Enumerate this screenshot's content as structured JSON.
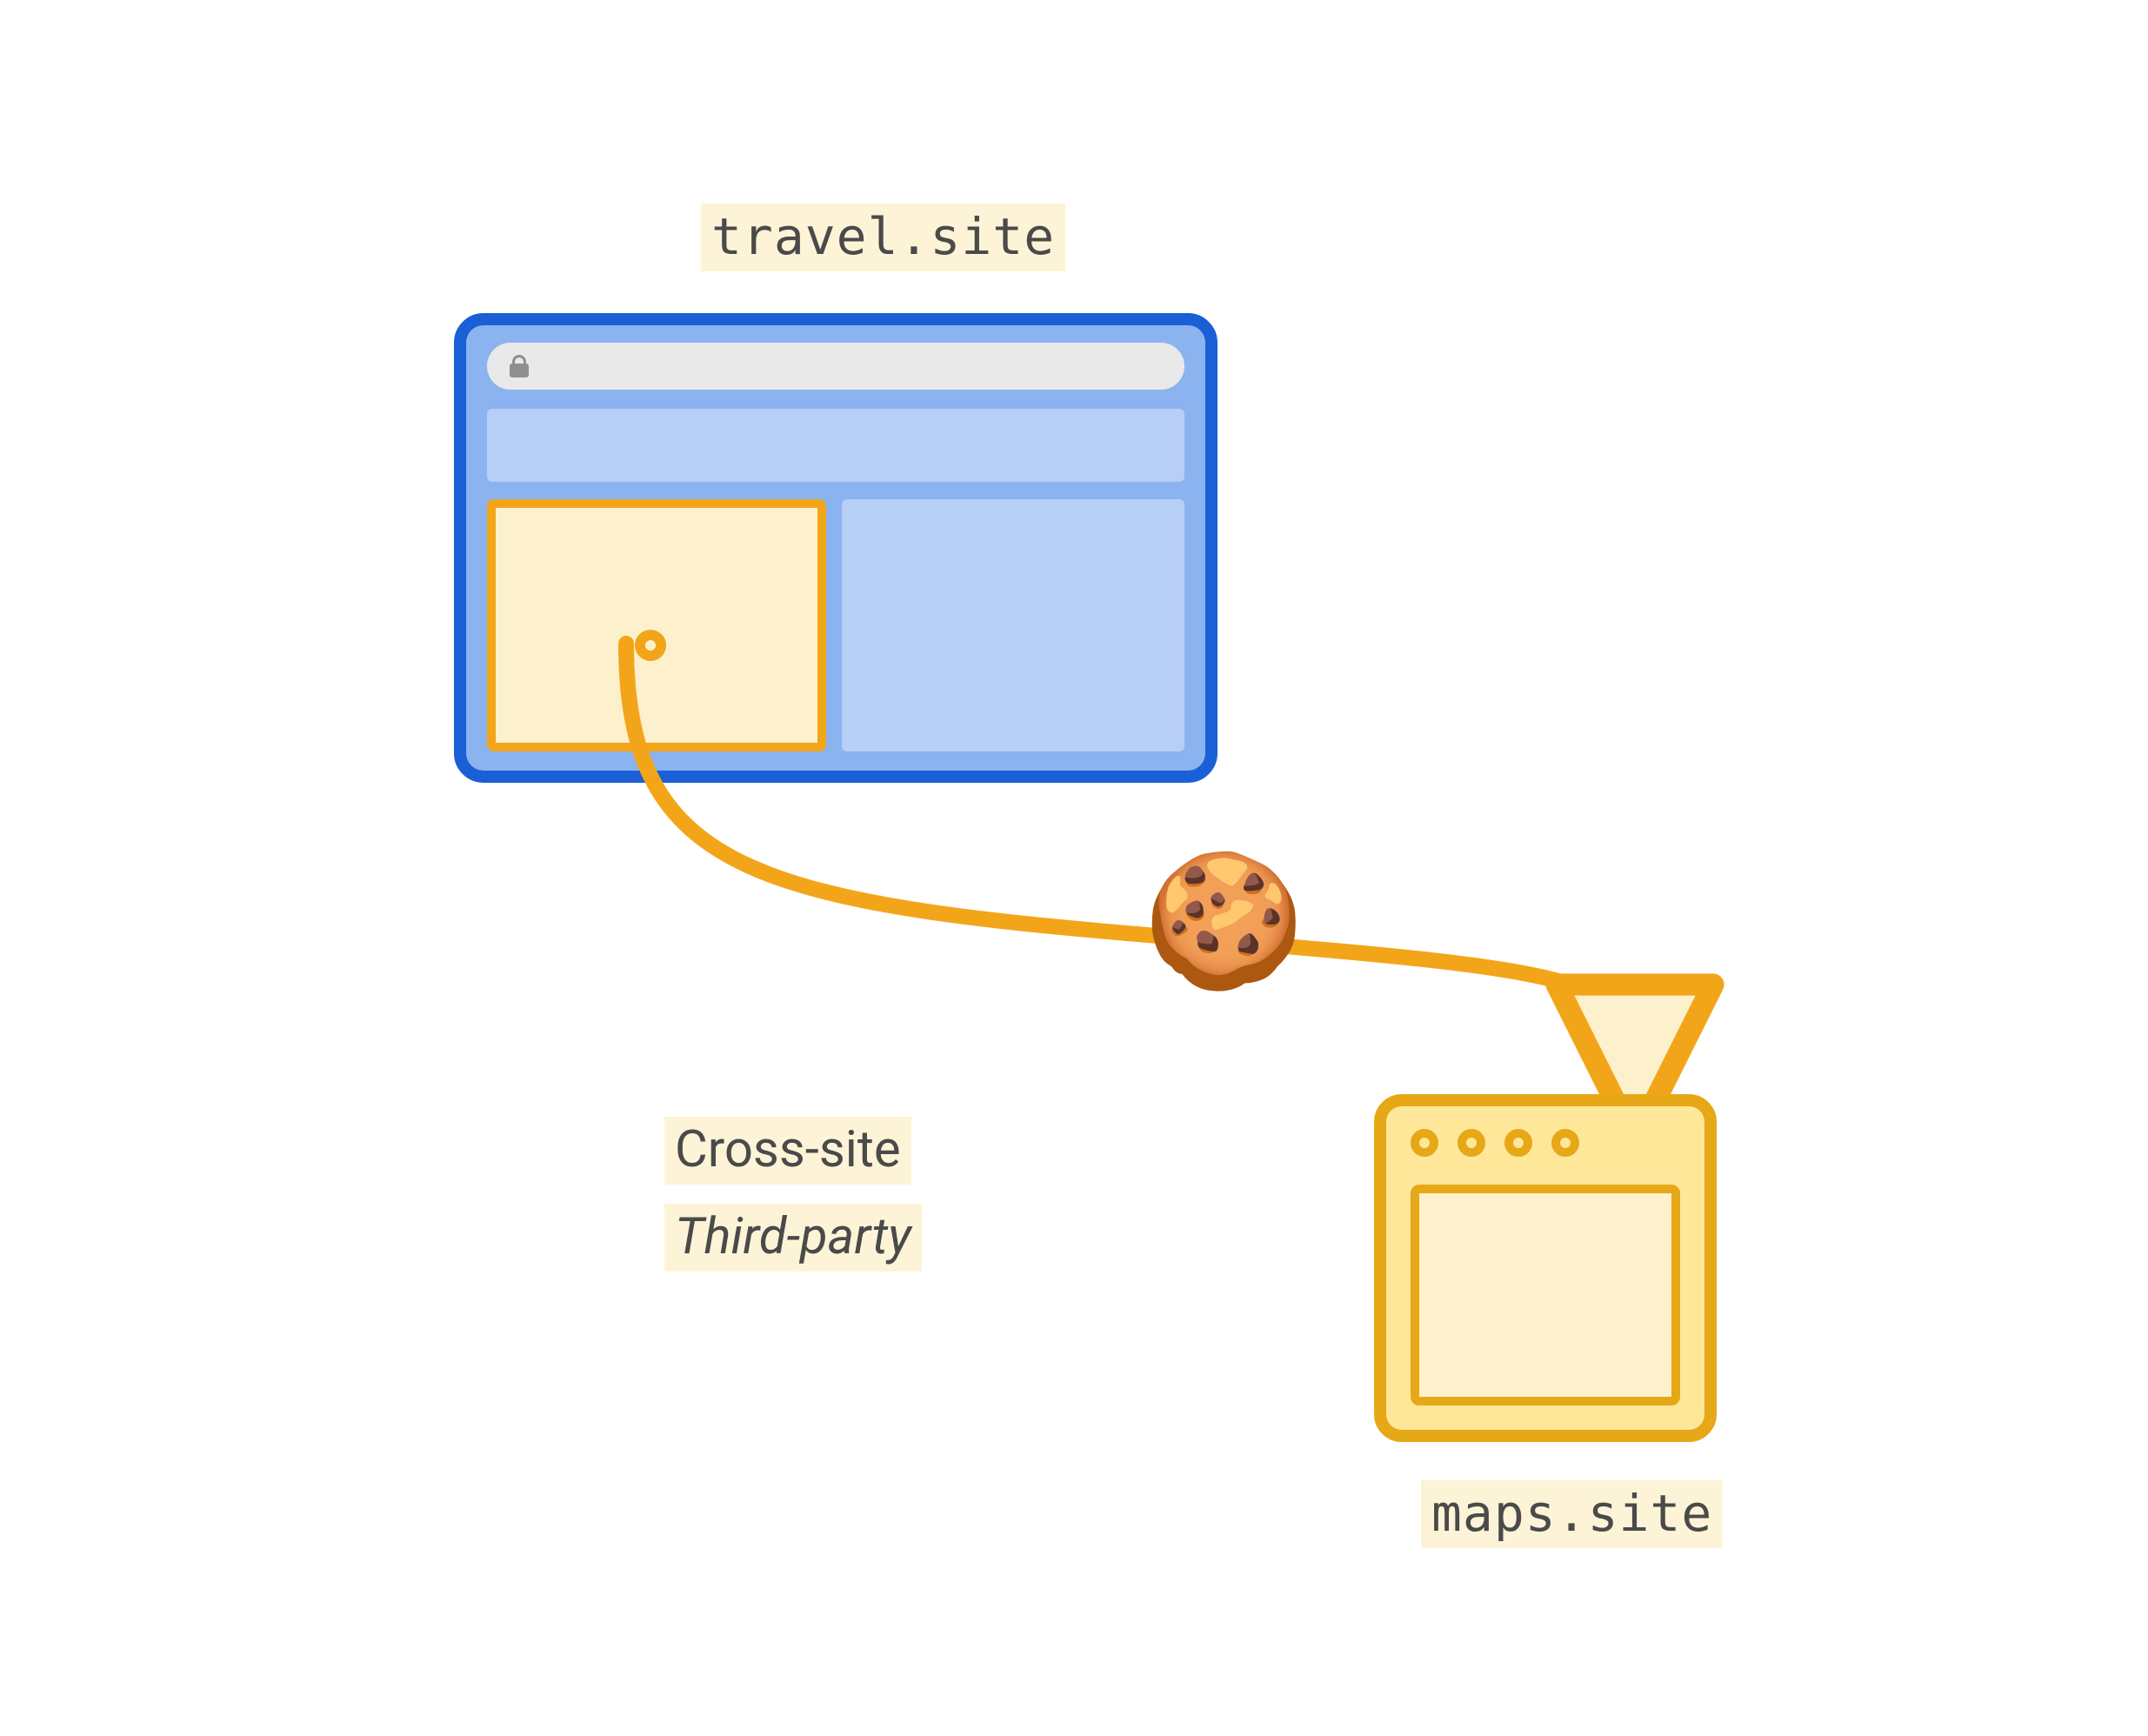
{
  "labels": {
    "top_site": "travel.site",
    "bottom_site": "maps.site",
    "cross_site": "Cross-site",
    "third_party": "Third-party"
  },
  "icons": {
    "lock": "lock-icon",
    "cookie": "cookie-icon"
  },
  "colors": {
    "browser_border": "#1a5fd6",
    "browser_fill": "#8bb3f0",
    "panel_blue": "#b7cef6",
    "accent_orange": "#f3a51a",
    "accent_orange_dark": "#e6a817",
    "highlight_bg": "#fdf4d7",
    "cream": "#fdf0cc",
    "server_fill": "#ffe79a",
    "text": "#4a4a4a"
  },
  "cookie_glyph": "🍪"
}
